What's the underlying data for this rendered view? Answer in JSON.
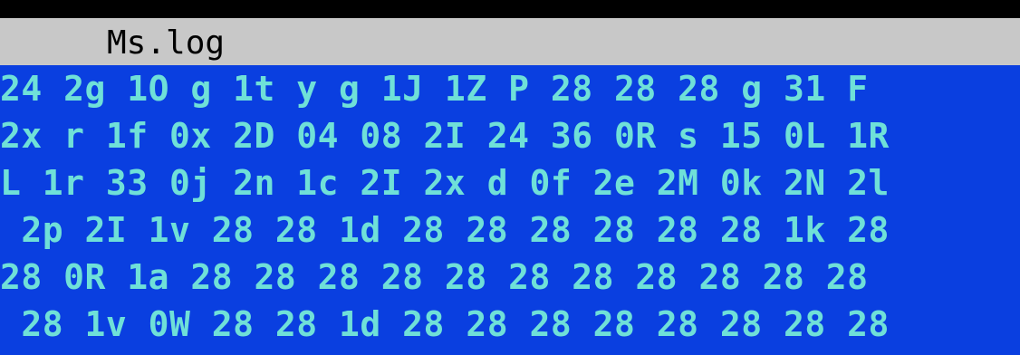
{
  "window": {
    "title": "Ms.log"
  },
  "colors": {
    "top_bar": "#000000",
    "title_bar": "#c8c8c8",
    "content_background": "#0a3fe0",
    "text": "#6fe0d8"
  },
  "content": {
    "lines": [
      "24 2g 1O g 1t y g 1J 1Z P 28 28 28 g 31 F",
      "2x r 1f 0x 2D 04 08 2I 24 36 0R s 15 0L 1R",
      "L 1r 33 0j 2n 1c 2I 2x d 0f 2e 2M 0k 2N 2l",
      " 2p 2I 1v 28 28 1d 28 28 28 28 28 28 1k 28",
      "28 0R 1a 28 28 28 28 28 28 28 28 28 28 28",
      " 28 1v 0W 28 28 1d 28 28 28 28 28 28 28 28"
    ]
  }
}
